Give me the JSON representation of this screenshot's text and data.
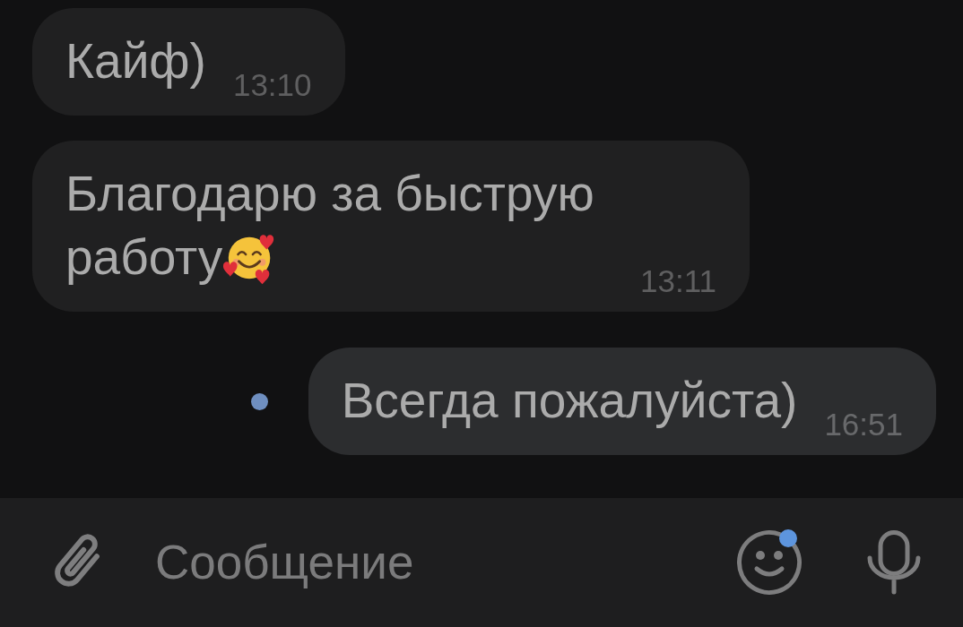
{
  "messages": [
    {
      "text": "Кайф)",
      "time": "13:10",
      "outgoing": false,
      "emoji": false,
      "unread": false
    },
    {
      "text": "Благодарю за быструю работу",
      "time": "13:11",
      "outgoing": false,
      "emoji": true,
      "unread": false
    },
    {
      "text": "Всегда пожалуйста)",
      "time": "16:51",
      "outgoing": true,
      "emoji": false,
      "unread": true
    }
  ],
  "composer": {
    "placeholder": "Сообщение",
    "emoji_badge": true
  }
}
